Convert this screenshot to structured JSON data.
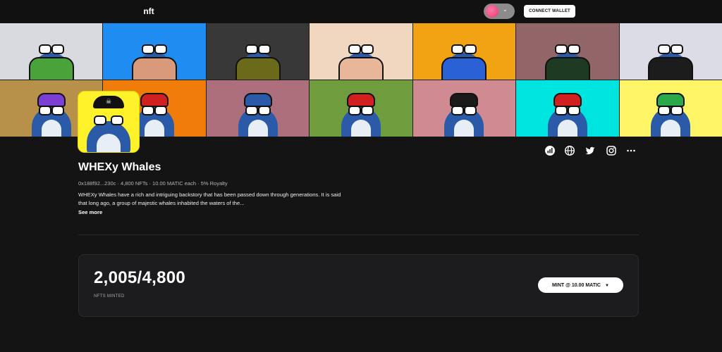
{
  "header": {
    "logo_text": "nft",
    "connect_label": "CONNECT WALLET",
    "wallet_caret": "⌄"
  },
  "banner": {
    "row1": [
      "#d9d9e0",
      "#1f8cf2",
      "#383838",
      "#f2d7c0",
      "#f2a313",
      "#926669",
      "#dcdce6"
    ],
    "row2": [
      "#b7904a",
      "#f07d0a",
      "#ae6f7c",
      "#6f9d3e",
      "#cf8a92",
      "#00e4e0",
      "#fff567"
    ]
  },
  "collection": {
    "title": "WHEXy Whales",
    "meta": "0x188f92...230c · 4,800 NFTs · 10.00 MATIC each · 5% Royalty",
    "description": "WHEXy Whales have a rich and intriguing backstory that has been passed down through generations. It is said that long ago, a group of majestic whales inhabited the waters of the...",
    "see_more": "See more"
  },
  "social": [
    "stats-icon",
    "globe-icon",
    "twitter-icon",
    "instagram-icon",
    "more-icon"
  ],
  "mint": {
    "count": "2,005/4,800",
    "label": "NFTS MINTED",
    "button": "MINT @ 10.00 MATIC",
    "caret": "▼"
  }
}
